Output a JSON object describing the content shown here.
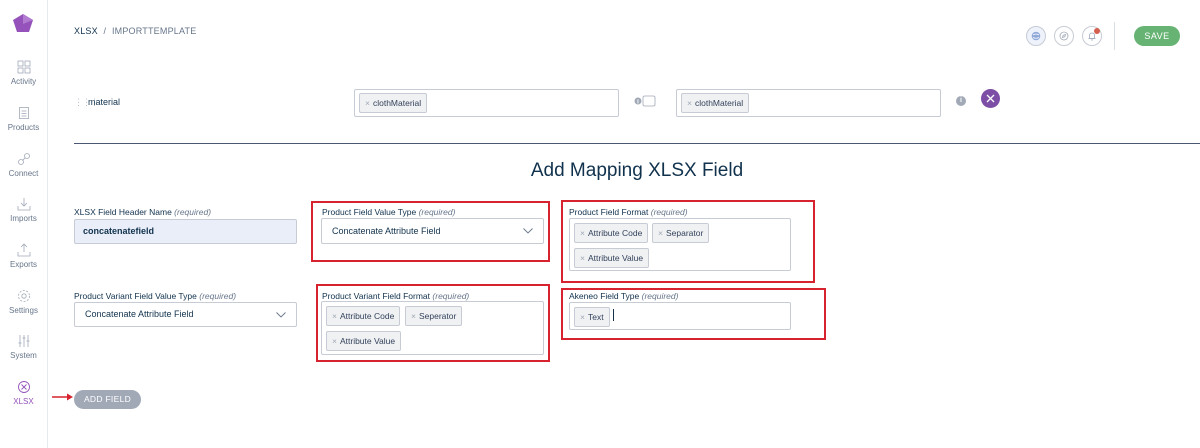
{
  "sidebar": {
    "items": [
      {
        "label": "Activity",
        "icon": "activity-icon"
      },
      {
        "label": "Products",
        "icon": "products-icon"
      },
      {
        "label": "Connect",
        "icon": "connect-icon"
      },
      {
        "label": "Imports",
        "icon": "imports-icon"
      },
      {
        "label": "Exports",
        "icon": "exports-icon"
      },
      {
        "label": "Settings",
        "icon": "settings-icon"
      },
      {
        "label": "System",
        "icon": "system-icon"
      },
      {
        "label": "XLSX",
        "icon": "xlsx-icon",
        "active": true
      }
    ]
  },
  "header": {
    "breadcrumb_root": "XLSX",
    "breadcrumb_sep": "/",
    "breadcrumb_current": "IMPORTTEMPLATE",
    "save_label": "SAVE"
  },
  "mapping_row": {
    "label": "material",
    "source_tag": "clothMaterial",
    "target_tag": "clothMaterial"
  },
  "form": {
    "title": "Add Mapping XLSX Field",
    "header_name_label": "XLSX Field Header Name",
    "header_name_value": "concatenatefield",
    "value_type_label": "Product Field Value Type",
    "value_type_selected": "Concatenate Attribute Field",
    "format_label": "Product Field Format",
    "format_tags": [
      "Attribute Code",
      "Separator",
      "Attribute Value"
    ],
    "variant_value_type_label": "Product Variant Field Value Type",
    "variant_value_type_selected": "Concatenate Attribute Field",
    "variant_format_label": "Product Variant Field Format",
    "variant_format_tags": [
      "Attribute Code",
      "Seperator",
      "Attribute Value"
    ],
    "akeneo_type_label": "Akeneo Field Type",
    "akeneo_type_tag": "Text",
    "required_text": "(required)",
    "add_field_label": "ADD FIELD"
  },
  "colors": {
    "accent": "#9452ba",
    "save": "#67b373",
    "highlight": "#d6232f",
    "text": "#11324d"
  }
}
